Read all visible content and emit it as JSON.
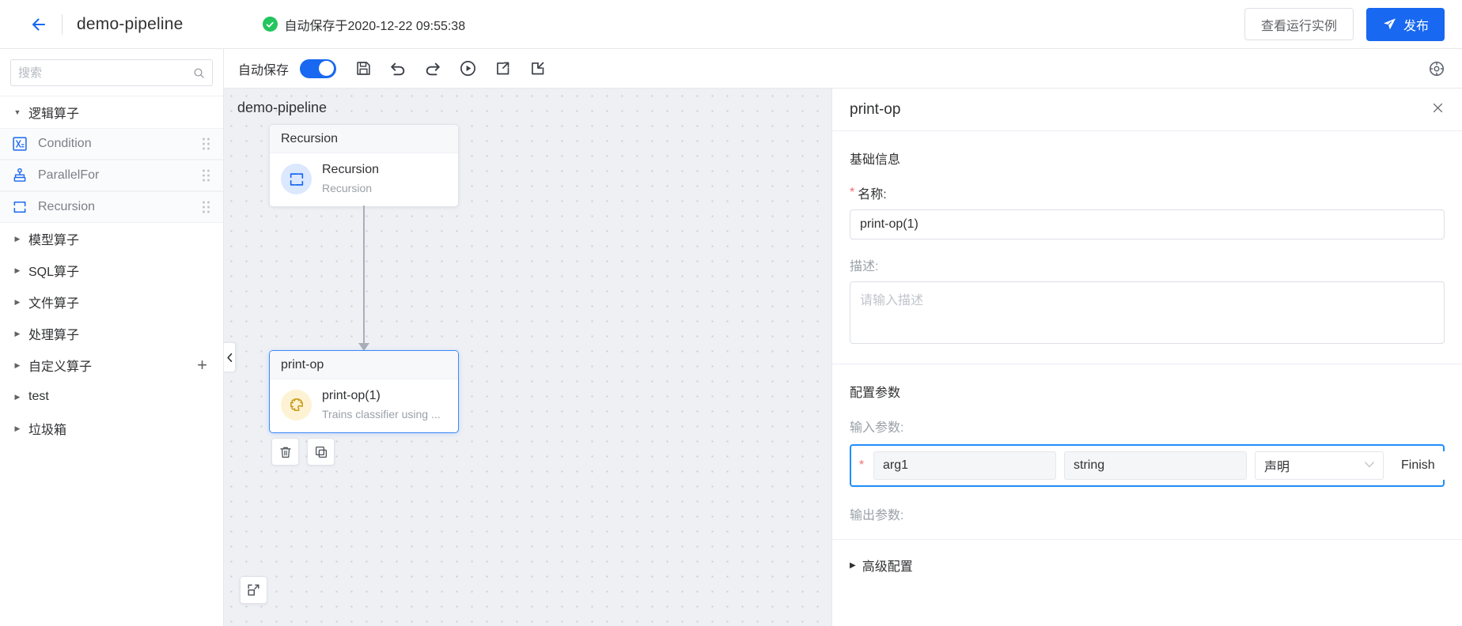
{
  "header": {
    "back_icon": "arrow-left-icon",
    "title": "demo-pipeline",
    "autosave_status": "自动保存于2020-12-22 09:55:38",
    "status_icon": "check-circle-icon",
    "view_runs_label": "查看运行实例",
    "publish_label": "发布",
    "publish_icon": "send-icon",
    "accent_color": "#1868f1",
    "success_color": "#22c55e"
  },
  "sidebar": {
    "search": {
      "placeholder": "搜索",
      "value": "",
      "icon": "search-icon"
    },
    "groups": [
      {
        "label": "逻辑算子",
        "expanded": true,
        "caret": "caret-down-icon"
      },
      {
        "label": "模型算子",
        "expanded": false,
        "caret": "caret-right-icon"
      },
      {
        "label": "SQL算子",
        "expanded": false,
        "caret": "caret-right-icon"
      },
      {
        "label": "文件算子",
        "expanded": false,
        "caret": "caret-right-icon"
      },
      {
        "label": "处理算子",
        "expanded": false,
        "caret": "caret-right-icon"
      },
      {
        "label": "自定义算子",
        "expanded": false,
        "caret": "caret-right-icon",
        "action": "add-icon"
      },
      {
        "label": "test",
        "expanded": false,
        "caret": "caret-right-icon"
      },
      {
        "label": "垃圾箱",
        "expanded": false,
        "caret": "caret-right-icon"
      }
    ],
    "operators": [
      {
        "label": "Condition",
        "icon": "condition-icon"
      },
      {
        "label": "ParallelFor",
        "icon": "parallel-for-icon"
      },
      {
        "label": "Recursion",
        "icon": "recursion-icon"
      }
    ]
  },
  "toolbar": {
    "autosave_label": "自动保存",
    "autosave_on": true,
    "icons": [
      {
        "name": "save-icon"
      },
      {
        "name": "undo-icon"
      },
      {
        "name": "redo-icon"
      },
      {
        "name": "run-icon"
      },
      {
        "name": "export-icon"
      },
      {
        "name": "import-icon"
      }
    ],
    "settings_icon": "settings-icon"
  },
  "canvas": {
    "title": "demo-pipeline",
    "collapse_icon": "chevron-left-icon",
    "fit_icon": "fit-screen-icon",
    "nodes": [
      {
        "header": "Recursion",
        "name": "Recursion",
        "desc": "Recursion",
        "icon": "recursion-icon",
        "avatar_color": "blue",
        "selected": false
      },
      {
        "header": "print-op",
        "name": "print-op(1)",
        "desc": "Trains classifier using ...",
        "icon": "puzzle-icon",
        "avatar_color": "yellow",
        "selected": true
      }
    ],
    "node_actions": [
      {
        "name": "delete-node-button",
        "icon": "trash-icon"
      },
      {
        "name": "copy-node-button",
        "icon": "copy-icon"
      }
    ]
  },
  "panel": {
    "title": "print-op",
    "close_icon": "close-icon",
    "basic_section": {
      "title": "基础信息",
      "name_label": "名称:",
      "name_required": "*",
      "name_value": "print-op(1)",
      "desc_label": "描述:",
      "desc_value": "",
      "desc_placeholder": "请输入描述"
    },
    "config_section": {
      "title": "配置参数",
      "input_label": "输入参数:",
      "output_label": "输出参数:",
      "input_params": [
        {
          "required": "*",
          "name": "arg1",
          "type": "string",
          "mode": "声明",
          "mode_chevron": "chevron-down-icon",
          "value": "Finish"
        }
      ],
      "highlight_color": "#1f8efa"
    },
    "advanced": {
      "label": "高级配置",
      "caret": "caret-right-icon",
      "expanded": false
    }
  }
}
